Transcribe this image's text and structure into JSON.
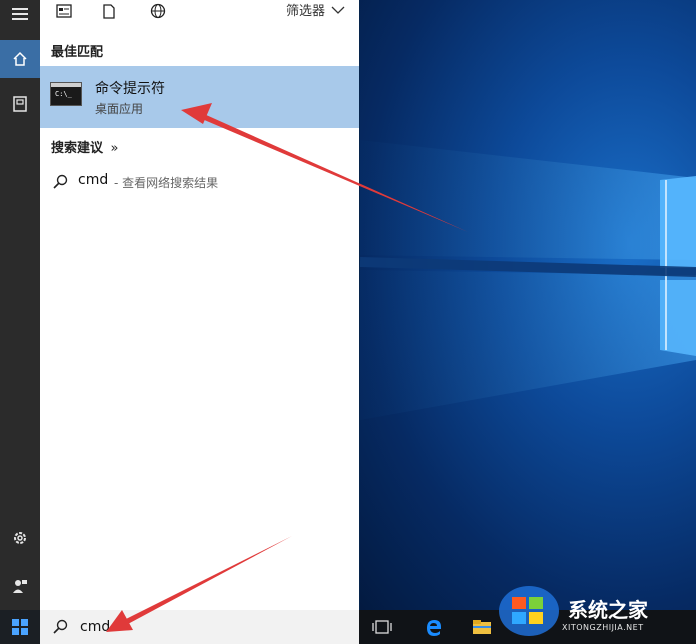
{
  "panel": {
    "filter_label": "筛选器",
    "best_match_title": "最佳匹配",
    "best_match": {
      "name": "命令提示符",
      "type": "桌面应用"
    },
    "suggestions_title": "搜索建议",
    "suggestions_chevron": "»",
    "suggestion": {
      "query": "cmd",
      "desc": "- 查看网络搜索结果"
    }
  },
  "taskbar": {
    "search_value": "cmd"
  },
  "watermark": {
    "text": "系统之家",
    "url": "XITONGZHIJIA.NET"
  },
  "colors": {
    "highlight": "#a8c9ea",
    "arrow": "#e03a3a",
    "rail": "#2b2b2b",
    "accent": "#3a6ea5"
  }
}
